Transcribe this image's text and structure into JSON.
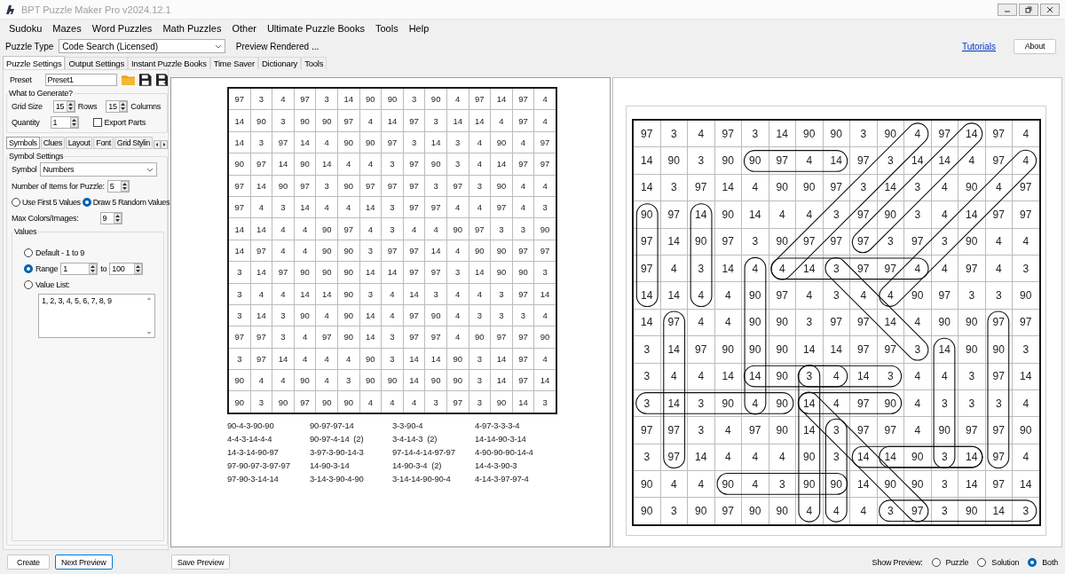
{
  "window": {
    "title": "BPT Puzzle Maker Pro v2024.12.1"
  },
  "menu": [
    "Sudoku",
    "Mazes",
    "Word Puzzles",
    "Math Puzzles",
    "Other",
    "Ultimate Puzzle Books",
    "Tools",
    "Help"
  ],
  "toolbar": {
    "puzzle_type_label": "Puzzle Type",
    "puzzle_type": "Code Search (Licensed)",
    "status": "Preview Rendered ...",
    "link": "Tutorials",
    "about_button": "About"
  },
  "tabs": [
    {
      "label": "Puzzle Settings",
      "selected": true
    },
    {
      "label": "Output Settings",
      "selected": false
    },
    {
      "label": "Instant Puzzle Books",
      "selected": false
    },
    {
      "label": "Time Saver",
      "selected": false
    },
    {
      "label": "Dictionary",
      "selected": false
    },
    {
      "label": "Tools",
      "selected": false
    }
  ],
  "preset": {
    "label": "Preset",
    "value": "Preset1"
  },
  "generate": {
    "title": "What to Generate?",
    "grid_size_label": "Grid Size",
    "rows": "15",
    "rows_label": "Rows",
    "columns": "15",
    "columns_label": "Columns",
    "quantity_label": "Quantity",
    "quantity": "1",
    "export_parts": {
      "label": "Export Parts",
      "checked": false
    }
  },
  "sub_tabs": [
    {
      "label": "Symbols",
      "selected": true
    },
    {
      "label": "Clues",
      "selected": false
    },
    {
      "label": "Layout",
      "selected": false
    },
    {
      "label": "Font",
      "selected": false
    },
    {
      "label": "Grid Stylin",
      "selected": false
    }
  ],
  "symbol_settings": {
    "title": "Symbol Settings",
    "symbol_label": "Symbol",
    "symbol": "Numbers",
    "items_label": "Number of Items for Puzzle:",
    "items": "5",
    "draw_options": [
      {
        "label": "Use First 5 Values",
        "selected": false
      },
      {
        "label": "Draw 5 Random Values",
        "selected": true
      }
    ],
    "max_label": "Max Colors/Images:",
    "max": "9"
  },
  "values": {
    "title": "Values",
    "options": [
      {
        "kind": "plain",
        "label": "Default - 1 to 9",
        "selected": false
      },
      {
        "kind": "range",
        "label": "Range",
        "from": "1",
        "to_label": "to",
        "to": "100",
        "selected": true
      },
      {
        "kind": "list",
        "label": "Value List:",
        "selected": false,
        "text": "1, 2, 3, 4, 5, 6, 7, 8, 9"
      }
    ]
  },
  "puzzle": {
    "grid": [
      [
        "97",
        "3",
        "4",
        "97",
        "3",
        "14",
        "90",
        "90",
        "3",
        "90",
        "4",
        "97",
        "14",
        "97",
        "4"
      ],
      [
        "14",
        "90",
        "3",
        "90",
        "90",
        "97",
        "4",
        "14",
        "97",
        "3",
        "14",
        "14",
        "4",
        "97",
        "4"
      ],
      [
        "14",
        "3",
        "97",
        "14",
        "4",
        "90",
        "90",
        "97",
        "3",
        "14",
        "3",
        "4",
        "90",
        "4",
        "97"
      ],
      [
        "90",
        "97",
        "14",
        "90",
        "14",
        "4",
        "4",
        "3",
        "97",
        "90",
        "3",
        "4",
        "14",
        "97",
        "97"
      ],
      [
        "97",
        "14",
        "90",
        "97",
        "3",
        "90",
        "97",
        "97",
        "97",
        "3",
        "97",
        "3",
        "90",
        "4",
        "4"
      ],
      [
        "97",
        "4",
        "3",
        "14",
        "4",
        "4",
        "14",
        "3",
        "97",
        "97",
        "4",
        "4",
        "97",
        "4",
        "3"
      ],
      [
        "14",
        "14",
        "4",
        "4",
        "90",
        "97",
        "4",
        "3",
        "4",
        "4",
        "90",
        "97",
        "3",
        "3",
        "90"
      ],
      [
        "14",
        "97",
        "4",
        "4",
        "90",
        "90",
        "3",
        "97",
        "97",
        "14",
        "4",
        "90",
        "90",
        "97",
        "97"
      ],
      [
        "3",
        "14",
        "97",
        "90",
        "90",
        "90",
        "14",
        "14",
        "97",
        "97",
        "3",
        "14",
        "90",
        "90",
        "3"
      ],
      [
        "3",
        "4",
        "4",
        "14",
        "14",
        "90",
        "3",
        "4",
        "14",
        "3",
        "4",
        "4",
        "3",
        "97",
        "14"
      ],
      [
        "3",
        "14",
        "3",
        "90",
        "4",
        "90",
        "14",
        "4",
        "97",
        "90",
        "4",
        "3",
        "3",
        "3",
        "4"
      ],
      [
        "97",
        "97",
        "3",
        "4",
        "97",
        "90",
        "14",
        "3",
        "97",
        "97",
        "4",
        "90",
        "97",
        "97",
        "90"
      ],
      [
        "3",
        "97",
        "14",
        "4",
        "4",
        "4",
        "90",
        "3",
        "14",
        "14",
        "90",
        "3",
        "14",
        "97",
        "4"
      ],
      [
        "90",
        "4",
        "4",
        "90",
        "4",
        "3",
        "90",
        "90",
        "14",
        "90",
        "90",
        "3",
        "14",
        "97",
        "14"
      ],
      [
        "90",
        "3",
        "90",
        "97",
        "90",
        "90",
        "4",
        "4",
        "4",
        "3",
        "97",
        "3",
        "90",
        "14",
        "3"
      ]
    ],
    "words": [
      "90-4-3-90-90",
      "90-97-97-14",
      "3-3-90-4",
      "4-97-3-3-3-4",
      "4-4-3-14-4-4",
      "90-97-4-14  (2)",
      "3-4-14-3  (2)",
      "14-14-90-3-14",
      "14-3-14-90-97",
      "3-97-3-90-14-3",
      "97-14-4-14-97-97",
      "4-90-90-90-14-4",
      "97-90-97-3-97-97",
      "14-90-3-14",
      "14-90-3-4  (2)",
      "14-4-3-90-3",
      "97-90-3-14-14",
      "3-14-3-90-4-90",
      "3-14-14-90-90-4",
      "4-14-3-97-97-4"
    ]
  },
  "solution": {
    "grid": [
      [
        "97",
        "3",
        "4",
        "97",
        "3",
        "14",
        "90",
        "90",
        "3",
        "90",
        "4",
        "97",
        "14",
        "97",
        "4"
      ],
      [
        "14",
        "90",
        "3",
        "90",
        "90",
        "97",
        "4",
        "14",
        "97",
        "3",
        "14",
        "14",
        "4",
        "97",
        "4"
      ],
      [
        "14",
        "3",
        "97",
        "14",
        "4",
        "90",
        "90",
        "97",
        "3",
        "14",
        "3",
        "4",
        "90",
        "4",
        "97"
      ],
      [
        "90",
        "97",
        "14",
        "90",
        "14",
        "4",
        "4",
        "3",
        "97",
        "90",
        "3",
        "4",
        "14",
        "97",
        "97"
      ],
      [
        "97",
        "14",
        "90",
        "97",
        "3",
        "90",
        "97",
        "97",
        "97",
        "3",
        "97",
        "3",
        "90",
        "4",
        "4"
      ],
      [
        "97",
        "4",
        "3",
        "14",
        "4",
        "4",
        "14",
        "3",
        "97",
        "97",
        "4",
        "4",
        "97",
        "4",
        "3"
      ],
      [
        "14",
        "14",
        "4",
        "4",
        "90",
        "97",
        "4",
        "3",
        "4",
        "4",
        "90",
        "97",
        "3",
        "3",
        "90"
      ],
      [
        "14",
        "97",
        "4",
        "4",
        "90",
        "90",
        "3",
        "97",
        "97",
        "14",
        "4",
        "90",
        "90",
        "97",
        "97"
      ],
      [
        "3",
        "14",
        "97",
        "90",
        "90",
        "90",
        "14",
        "14",
        "97",
        "97",
        "3",
        "14",
        "90",
        "90",
        "3"
      ],
      [
        "3",
        "4",
        "4",
        "14",
        "14",
        "90",
        "3",
        "4",
        "14",
        "3",
        "4",
        "4",
        "3",
        "97",
        "14"
      ],
      [
        "3",
        "14",
        "3",
        "90",
        "4",
        "90",
        "14",
        "4",
        "97",
        "90",
        "4",
        "3",
        "3",
        "3",
        "4"
      ],
      [
        "97",
        "97",
        "3",
        "4",
        "97",
        "90",
        "14",
        "3",
        "97",
        "97",
        "4",
        "90",
        "97",
        "97",
        "90"
      ],
      [
        "3",
        "97",
        "14",
        "4",
        "4",
        "4",
        "90",
        "3",
        "14",
        "14",
        "90",
        "3",
        "14",
        "97",
        "4"
      ],
      [
        "90",
        "4",
        "4",
        "90",
        "4",
        "3",
        "90",
        "90",
        "14",
        "90",
        "90",
        "3",
        "14",
        "97",
        "14"
      ],
      [
        "90",
        "3",
        "90",
        "97",
        "90",
        "90",
        "4",
        "4",
        "4",
        "3",
        "97",
        "3",
        "90",
        "14",
        "3"
      ]
    ]
  },
  "bottom": {
    "buttons": [
      {
        "label": "Create",
        "focused": false
      },
      {
        "label": "Next Preview",
        "focused": true
      }
    ],
    "save_button": "Save Preview",
    "show_preview_label": "Show Preview:",
    "show_preview": [
      {
        "label": "Puzzle",
        "selected": false
      },
      {
        "label": "Solution",
        "selected": false
      },
      {
        "label": "Both",
        "selected": true
      }
    ]
  }
}
